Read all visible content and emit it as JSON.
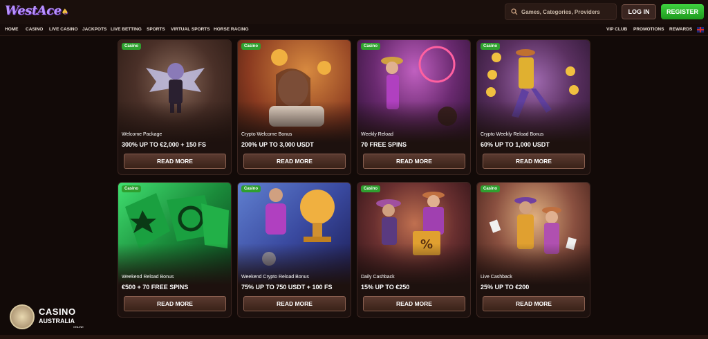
{
  "header": {
    "logo": "WestAce",
    "search_placeholder": "Games, Categories, Providers",
    "login": "LOG IN",
    "register": "REGISTER"
  },
  "nav": {
    "left": [
      "HOME",
      "CASINO",
      "LIVE CASINO",
      "JACKPOTS",
      "LIVE BETTING",
      "SPORTS",
      "VIRTUAL SPORTS",
      "HORSE RACING"
    ],
    "right": [
      "VIP CLUB",
      "PROMOTIONS",
      "REWARDS"
    ]
  },
  "cards": [
    {
      "badge": "Casino",
      "category": "Welcome Package",
      "offer": "300% UP TO €2,000 + 150 FS",
      "button": "READ MORE"
    },
    {
      "badge": "Casino",
      "category": "Crypto Welcome Bonus",
      "offer": "200% UP TO 3,000 USDT",
      "button": "READ MORE"
    },
    {
      "badge": "Casino",
      "category": "Weekly Reload",
      "offer": "70 FREE SPINS",
      "button": "READ MORE"
    },
    {
      "badge": "Casino",
      "category": "Crypto Weekly Reload Bonus",
      "offer": "60% UP TO 1,000 USDT",
      "button": "READ MORE"
    },
    {
      "badge": "Casino",
      "category": "Weekend Reload Bonus",
      "offer": "€500 + 70 FREE SPINS",
      "button": "READ MORE"
    },
    {
      "badge": "Casino",
      "category": "Weekend Crypto Reload Bonus",
      "offer": "75% UP TO 750 USDT + 100 FS",
      "button": "READ MORE"
    },
    {
      "badge": "Casino",
      "category": "Daily Cashback",
      "offer": "15% UP TO €250",
      "button": "READ MORE"
    },
    {
      "badge": "Casino",
      "category": "Live Cashback",
      "offer": "25% UP TO €200",
      "button": "READ MORE"
    }
  ],
  "watermark": {
    "line1": "CASINO",
    "line2": "AUSTRALIA",
    "line3": "ONLINE"
  },
  "colors": {
    "accent_green": "#2fa02f",
    "background": "#120a08",
    "logo_purple": "#b892ff"
  }
}
